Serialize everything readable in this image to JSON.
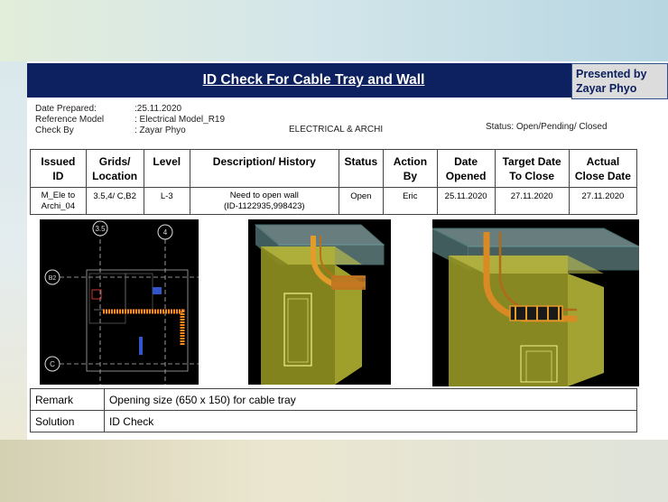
{
  "header": {
    "title": "ID Check For Cable Tray and Wall",
    "presented_by_label": "Presented by",
    "presenter": "Zayar Phyo"
  },
  "meta": [
    {
      "key": "Date Prepared:",
      "value": ":25.11.2020"
    },
    {
      "key": "Reference Model",
      "value": ": Electrical Model_R19"
    },
    {
      "key": "Check By",
      "value": ": Zayar Phyo"
    }
  ],
  "discipline": "ELECTRICAL & ARCHI",
  "status_legend": "Status: Open/Pending/ Closed",
  "table": {
    "headers": [
      [
        "Issued",
        "ID"
      ],
      [
        "Grids/",
        "Location"
      ],
      [
        "Level",
        ""
      ],
      [
        "Description/ History",
        ""
      ],
      [
        "Status",
        ""
      ],
      [
        "Action",
        "By"
      ],
      [
        "Date",
        "Opened"
      ],
      [
        "Target Date",
        "To Close"
      ],
      [
        "Actual",
        "Close Date"
      ]
    ],
    "row": {
      "issued_id": [
        "M_Ele to",
        "Archi_04"
      ],
      "grids": "3.5,4/ C,B2",
      "level": "L-3",
      "description": [
        "Need to open wall",
        "(ID-1122935,998423)"
      ],
      "status": "Open",
      "action_by": "Eric",
      "date_opened": "25.11.2020",
      "target_date": "27.11.2020",
      "actual_close": "27.11.2020"
    }
  },
  "plan_grid_labels": {
    "col1": "3.5",
    "col2": "4",
    "row1": "B2",
    "row2": "C"
  },
  "remark": {
    "label": "Remark",
    "value": "Opening size (650 x 150) for cable tray"
  },
  "solution": {
    "label": "Solution",
    "value": "ID Check"
  }
}
